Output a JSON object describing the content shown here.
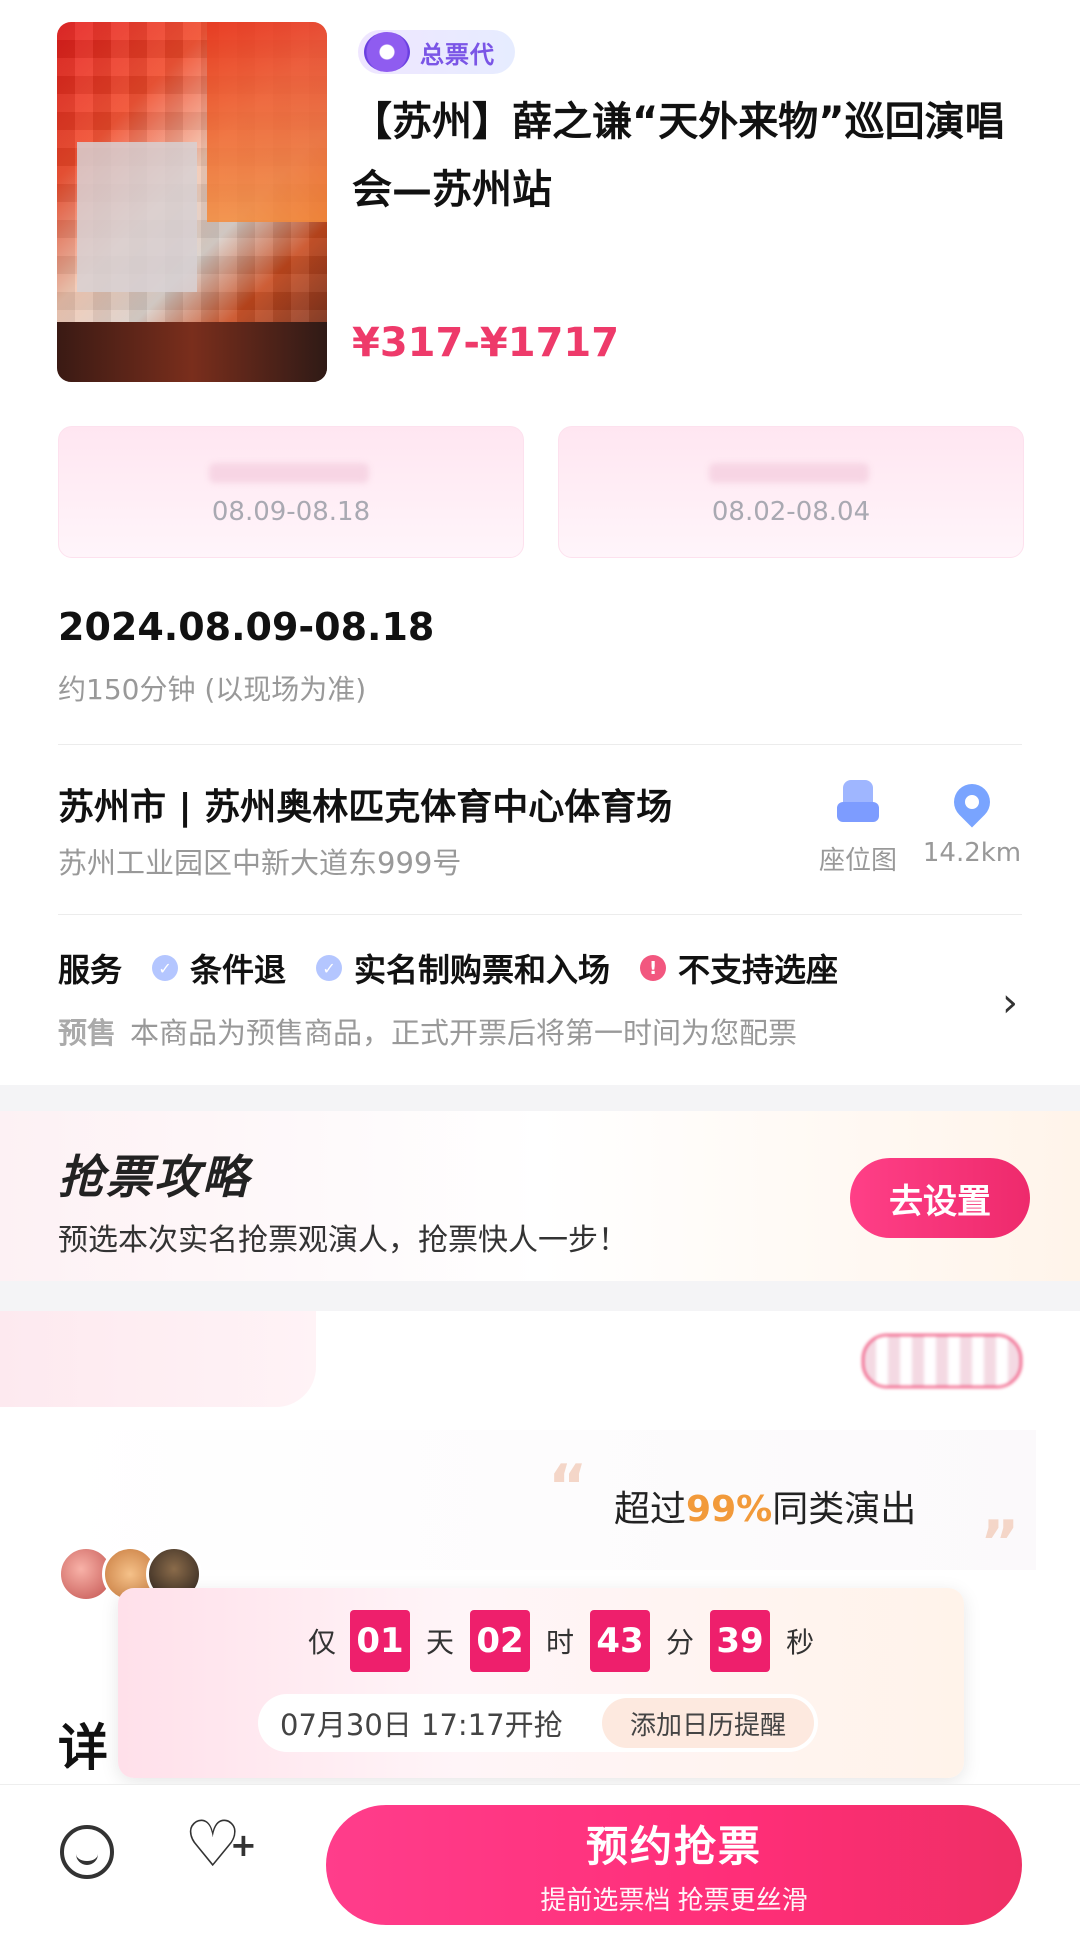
{
  "header": {
    "badge": "总票代",
    "title": "【苏州】薛之谦“天外来物”巡回演唱会—苏州站",
    "price": "¥317-¥1717"
  },
  "sessions": [
    {
      "dates": "08.09-08.18"
    },
    {
      "dates": "08.02-08.04"
    }
  ],
  "event": {
    "date": "2024.08.09-08.18",
    "duration": "约150分钟 (以现场为准)"
  },
  "venue": {
    "name": "苏州市 | 苏州奥林匹克体育中心体育场",
    "address": "苏州工业园区中新大道东999号",
    "seatmap_label": "座位图",
    "distance": "14.2km"
  },
  "services": {
    "heading": "服务",
    "items": [
      {
        "label": "条件退",
        "icon": "check-icon"
      },
      {
        "label": "实名制购票和入场",
        "icon": "check-icon"
      },
      {
        "label": "不支持选座",
        "icon": "warning-icon"
      }
    ],
    "presale_tag": "预售",
    "presale_text": "本商品为预售商品，正式开票后将第一时间为您配票"
  },
  "strategy": {
    "title": "抢票攻略",
    "subtitle": "预选本次实名抢票观演人，抢票快人一步！",
    "button": "去设置"
  },
  "popularity": {
    "prefix": "超过",
    "percent": "99%",
    "suffix": "同类演出"
  },
  "details": {
    "heading": "详"
  },
  "countdown": {
    "prefix": "仅",
    "days": "01",
    "days_unit": "天",
    "hours": "02",
    "hours_unit": "时",
    "minutes": "43",
    "minutes_unit": "分",
    "seconds": "39",
    "seconds_unit": "秒",
    "open_time": "07月30日 17:17开抢",
    "calendar_button": "添加日历提醒"
  },
  "bottom_bar": {
    "buy_label": "预约抢票",
    "buy_sub": "提前选票档 抢票更丝滑"
  },
  "colors": {
    "accent": "#EE3A6A",
    "price": "#EE3A6A",
    "highlight": "#F29A3A",
    "badge": "#7A55E6"
  }
}
